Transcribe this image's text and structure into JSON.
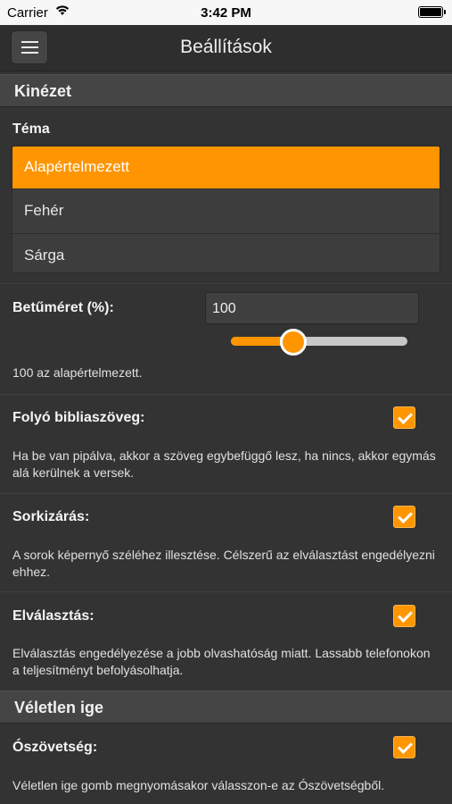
{
  "status": {
    "carrier": "Carrier",
    "time": "3:42 PM"
  },
  "nav": {
    "title": "Beállítások",
    "menu_icon": "hamburger-menu-icon"
  },
  "sections": {
    "appearance": "Kinézet",
    "random_verse": "Véletlen ige"
  },
  "theme": {
    "label": "Téma",
    "options": [
      "Alapértelmezett",
      "Fehér",
      "Sárga"
    ],
    "selected": "Alapértelmezett"
  },
  "font_size": {
    "label": "Betűméret (%):",
    "value": "100",
    "slider_fraction": 0.28,
    "hint": "100 az alapértelmezett."
  },
  "settings": {
    "continuous": {
      "label": "Folyó bibliaszöveg:",
      "checked": true,
      "description": "Ha be van pipálva, akkor a szöveg egybefüggő lesz, ha nincs, akkor egymás alá kerülnek a versek."
    },
    "justify": {
      "label": "Sorkizárás:",
      "checked": true,
      "description": "A sorok képernyő széléhez illesztése. Célszerű az elválasztást engedélyezni ehhez."
    },
    "hyphenation": {
      "label": "Elválasztás:",
      "checked": true,
      "description": "Elválasztás engedélyezése a jobb olvashatóság miatt. Lassabb telefonokon a teljesítményt befolyásolhatja."
    },
    "old_testament": {
      "label": "Ószövetség:",
      "checked": true,
      "description": "Véletlen ige gomb megnyomásakor válasszon-e az Ószövetségből."
    }
  },
  "colors": {
    "accent": "#ff9500",
    "background": "#333333",
    "section": "#454545"
  }
}
